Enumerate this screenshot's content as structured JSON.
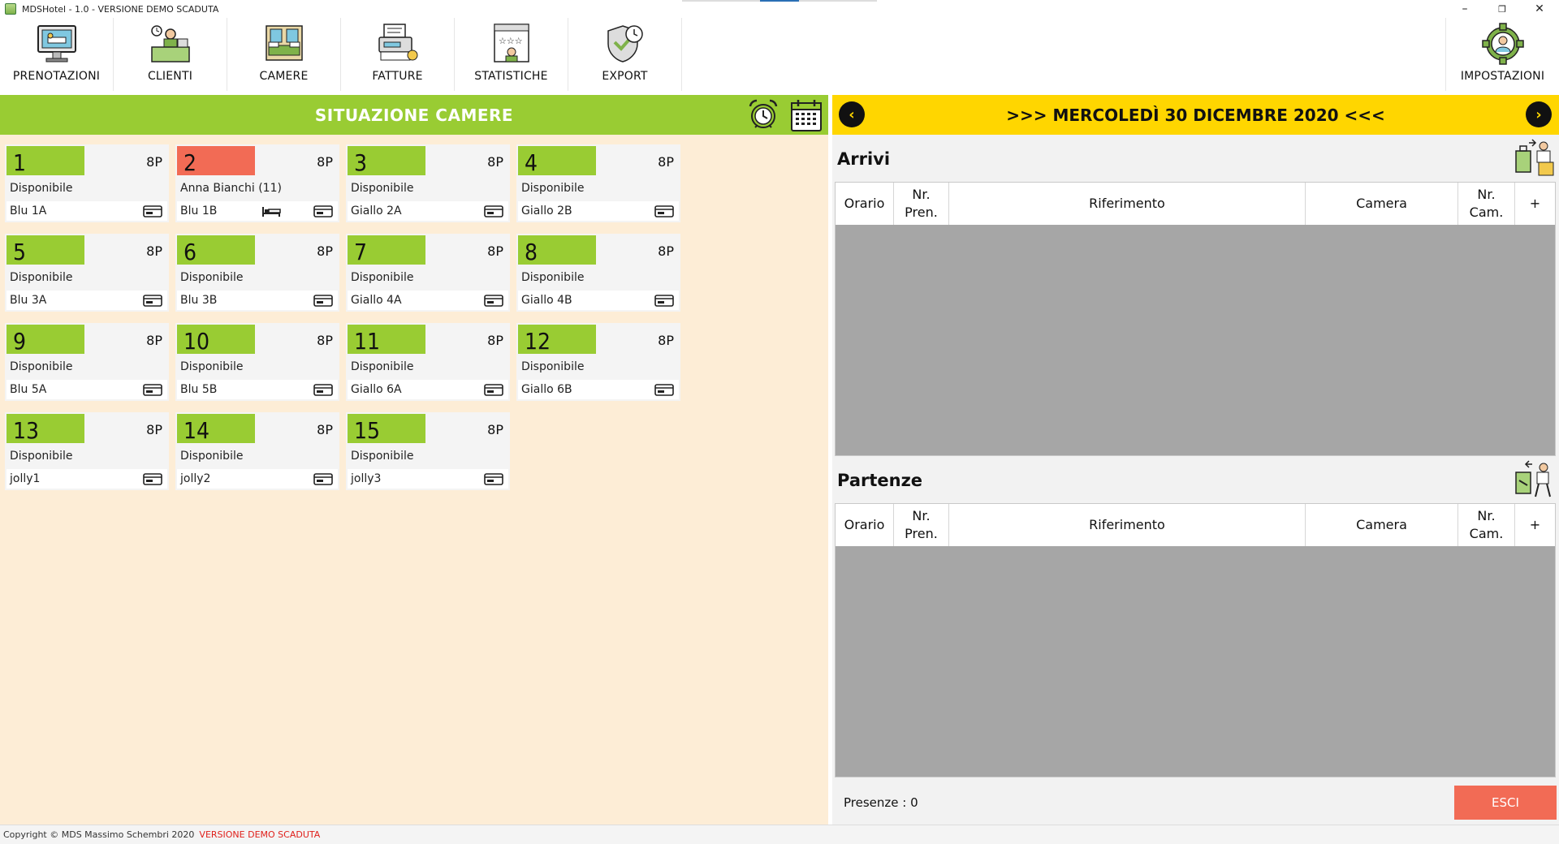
{
  "window": {
    "title": "MDSHotel - 1.0 - VERSIONE DEMO SCADUTA",
    "minimize": "–",
    "restore": "❐",
    "close": "✕"
  },
  "toolbar": {
    "prenotazioni": "PRENOTAZIONI",
    "clienti": "CLIENTI",
    "camere": "CAMERE",
    "fatture": "FATTURE",
    "statistiche": "STATISTICHE",
    "export": "EXPORT",
    "impostazioni": "IMPOSTAZIONI"
  },
  "left": {
    "title": "SITUAZIONE CAMERE",
    "rooms": [
      {
        "num": "1",
        "cap": "8P",
        "status": "Disponibile",
        "name": "Blu 1A"
      },
      {
        "num": "2",
        "cap": "8P",
        "status": "Anna Bianchi (11)",
        "name": "Blu 1B"
      },
      {
        "num": "3",
        "cap": "8P",
        "status": "Disponibile",
        "name": "Giallo 2A"
      },
      {
        "num": "4",
        "cap": "8P",
        "status": "Disponibile",
        "name": "Giallo 2B"
      },
      {
        "num": "5",
        "cap": "8P",
        "status": "Disponibile",
        "name": "Blu 3A"
      },
      {
        "num": "6",
        "cap": "8P",
        "status": "Disponibile",
        "name": "Blu 3B"
      },
      {
        "num": "7",
        "cap": "8P",
        "status": "Disponibile",
        "name": "Giallo 4A"
      },
      {
        "num": "8",
        "cap": "8P",
        "status": "Disponibile",
        "name": "Giallo 4B"
      },
      {
        "num": "9",
        "cap": "8P",
        "status": "Disponibile",
        "name": "Blu 5A"
      },
      {
        "num": "10",
        "cap": "8P",
        "status": "Disponibile",
        "name": "Blu 5B"
      },
      {
        "num": "11",
        "cap": "8P",
        "status": "Disponibile",
        "name": "Giallo 6A"
      },
      {
        "num": "12",
        "cap": "8P",
        "status": "Disponibile",
        "name": "Giallo 6B"
      },
      {
        "num": "13",
        "cap": "8P",
        "status": "Disponibile",
        "name": "jolly1"
      },
      {
        "num": "14",
        "cap": "8P",
        "status": "Disponibile",
        "name": "jolly2"
      },
      {
        "num": "15",
        "cap": "8P",
        "status": "Disponibile",
        "name": "jolly3"
      }
    ]
  },
  "right": {
    "date": ">>> MERCOLEDÌ 30 DICEMBRE 2020 <<<",
    "prev": "‹",
    "next": "›",
    "arrivi": {
      "title": "Arrivi",
      "columns": [
        "Orario",
        "Nr.\nPren.",
        "Riferimento",
        "Camera",
        "Nr.\nCam.",
        "+"
      ]
    },
    "partenze": {
      "title": "Partenze",
      "columns": [
        "Orario",
        "Nr.\nPren.",
        "Riferimento",
        "Camera",
        "Nr.\nCam.",
        "+"
      ]
    },
    "presenze": "Presenze : 0",
    "esci": "ESCI"
  },
  "statusbar": {
    "copyright": "Copyright © MDS Massimo Schembri 2020",
    "warning": "VERSIONE DEMO SCADUTA"
  },
  "colors": {
    "green": "#99cc33",
    "occupied": "#f26b55",
    "yellow": "#ffd600",
    "left_bg": "#fdedd6",
    "grid_bg": "#a6a6a6"
  }
}
